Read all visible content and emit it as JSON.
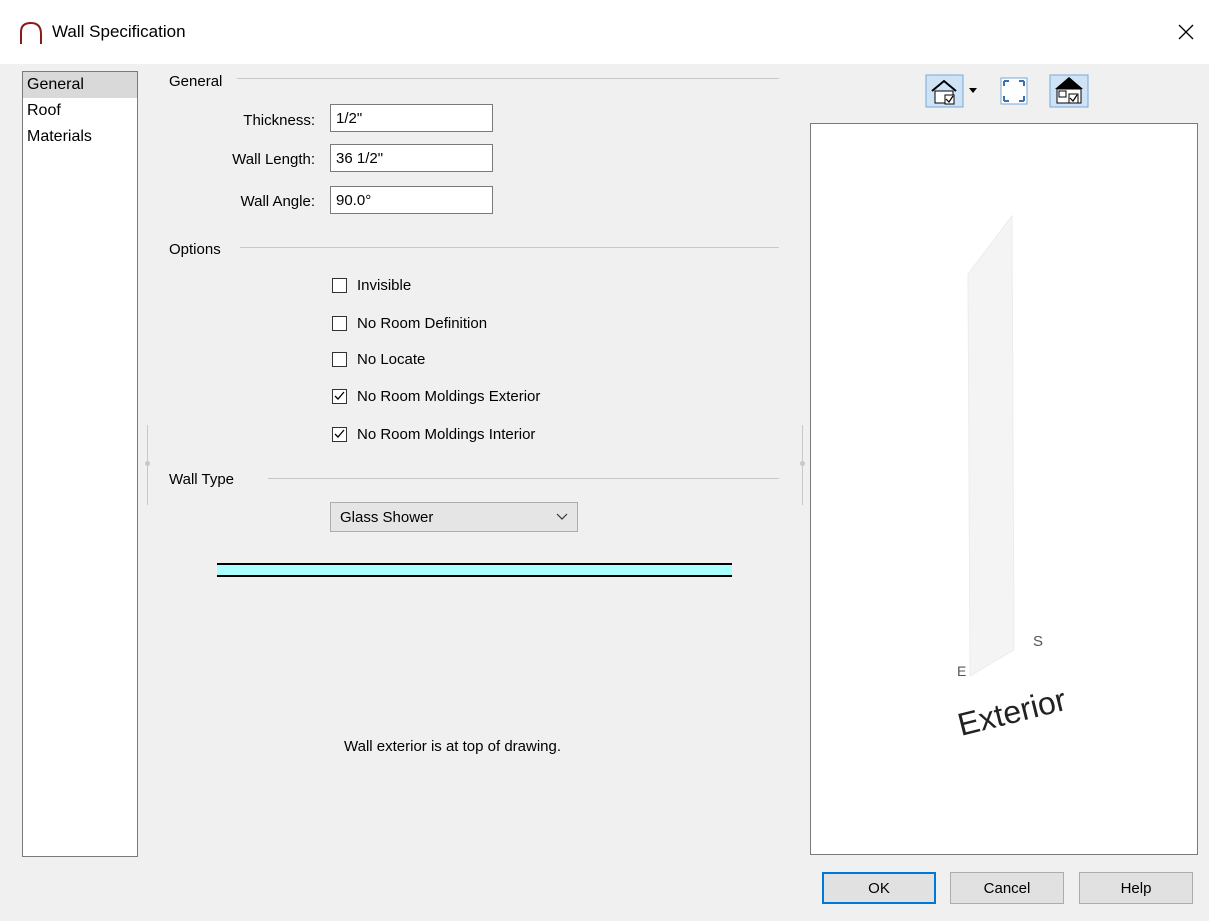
{
  "window": {
    "title": "Wall Specification",
    "close_icon": "close-icon",
    "app_icon": "arch-icon"
  },
  "sidebar": {
    "items": [
      {
        "label": "General",
        "selected": true
      },
      {
        "label": "Roof",
        "selected": false
      },
      {
        "label": "Materials",
        "selected": false
      }
    ]
  },
  "general": {
    "heading": "General",
    "thickness": {
      "label": "Thickness:",
      "value": "1/2\""
    },
    "wall_length": {
      "label": "Wall Length:",
      "value": "36 1/2\""
    },
    "wall_angle": {
      "label": "Wall Angle:",
      "value": "90.0°"
    }
  },
  "options": {
    "heading": "Options",
    "items": [
      {
        "label": "Invisible",
        "checked": false
      },
      {
        "label": "No Room Definition",
        "checked": false
      },
      {
        "label": "No Locate",
        "checked": false
      },
      {
        "label": "No Room Moldings Exterior",
        "checked": true
      },
      {
        "label": "No Room Moldings Interior",
        "checked": true
      }
    ]
  },
  "wall_type": {
    "heading": "Wall Type",
    "selected": "Glass Shower",
    "swatch_color": "#aaffff",
    "note": "Wall exterior is at top of drawing."
  },
  "preview": {
    "toolbar": [
      "camera-view-icon",
      "fit-view-icon",
      "show-layers-icon"
    ],
    "labels": {
      "s": "S",
      "e": "E",
      "side": "Exterior"
    }
  },
  "buttons": {
    "ok": "OK",
    "cancel": "Cancel",
    "help": "Help"
  },
  "colors": {
    "accent": "#0078d7",
    "dialog_bg": "#f0f0f0"
  }
}
